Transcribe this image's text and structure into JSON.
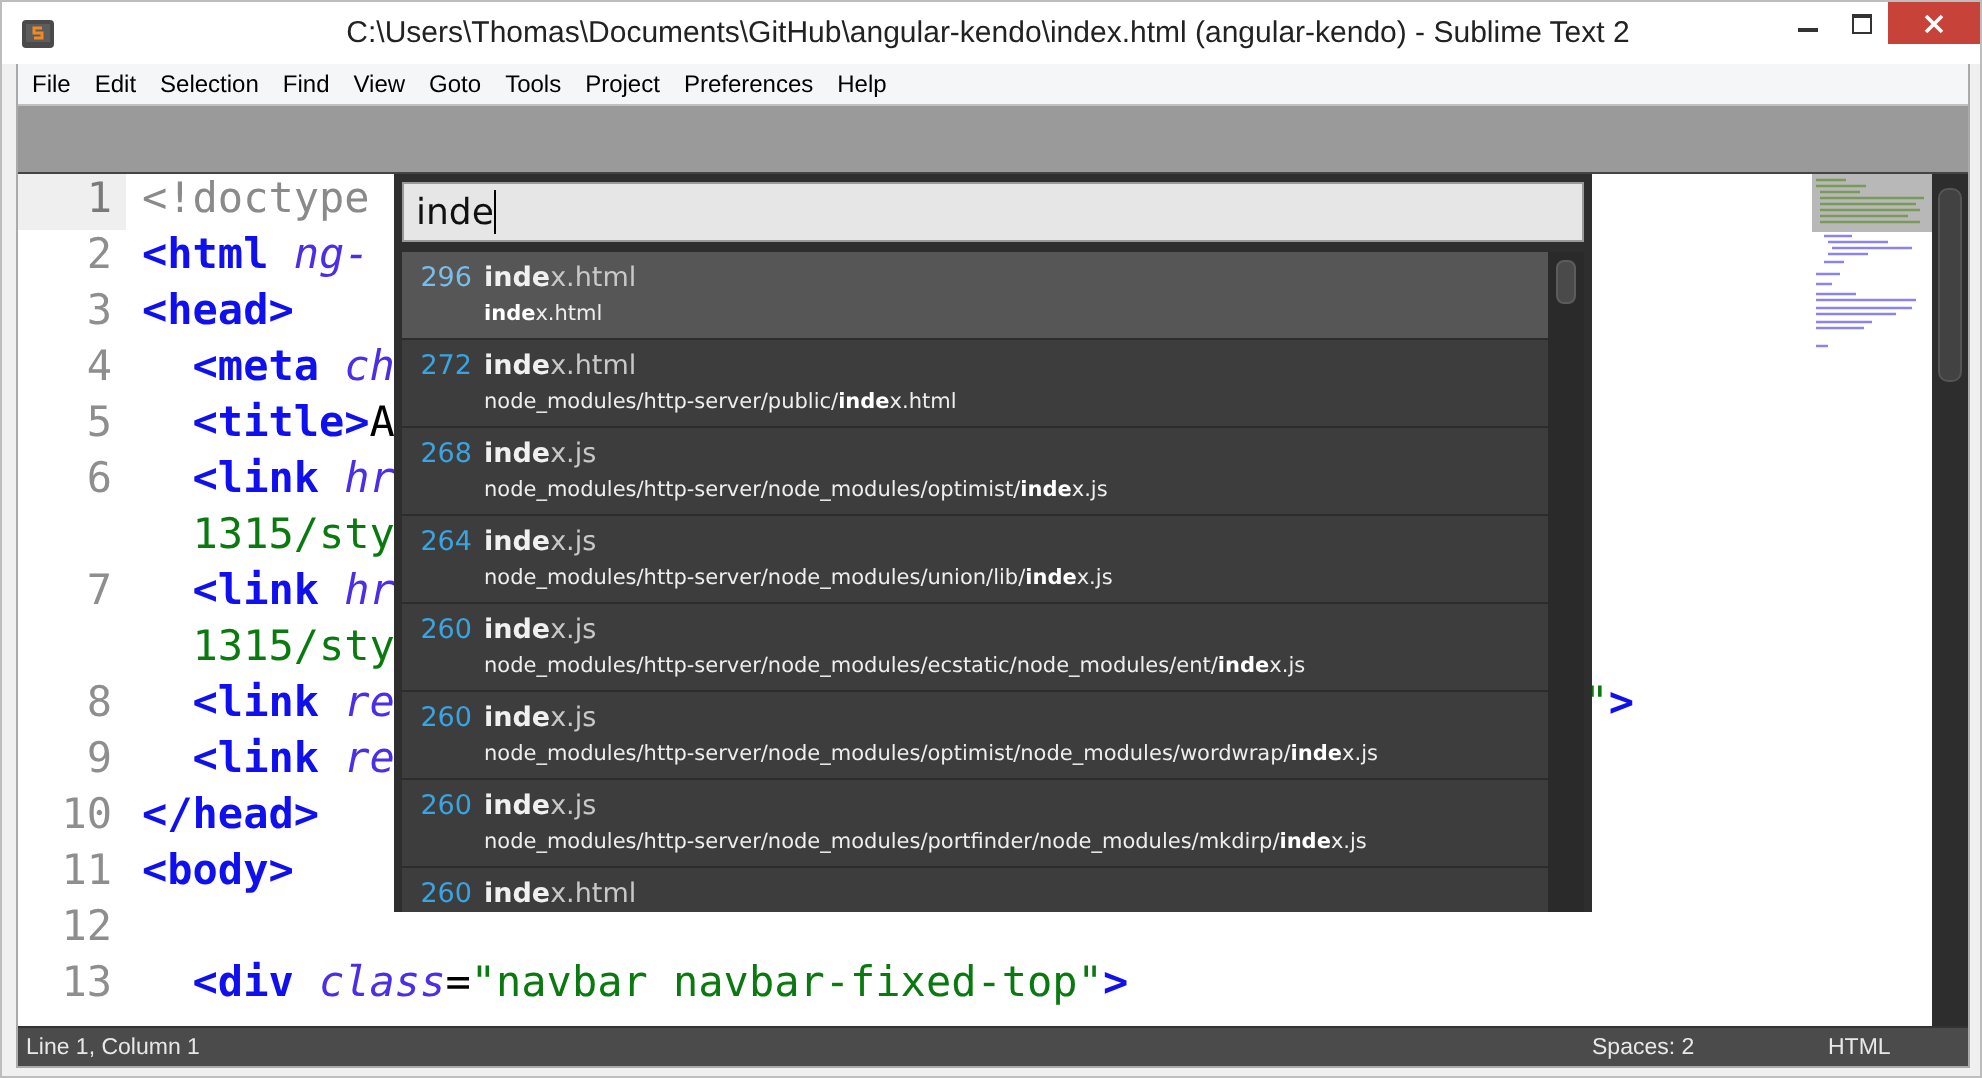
{
  "window": {
    "title": "C:\\Users\\Thomas\\Documents\\GitHub\\angular-kendo\\index.html (angular-kendo) - Sublime Text 2"
  },
  "menu": [
    "File",
    "Edit",
    "Selection",
    "Find",
    "View",
    "Goto",
    "Tools",
    "Project",
    "Preferences",
    "Help"
  ],
  "editor": {
    "lines": [
      {
        "number": "1",
        "current": true,
        "tokens": [
          {
            "kind": "doctype",
            "text": "<!doctype"
          }
        ]
      },
      {
        "number": "2",
        "current": false,
        "tokens": [
          {
            "kind": "tag",
            "text": "<html"
          },
          {
            "kind": "attr",
            "text": " ng-"
          }
        ]
      },
      {
        "number": "3",
        "current": false,
        "tokens": [
          {
            "kind": "tag",
            "text": "<head>"
          }
        ]
      },
      {
        "number": "4",
        "current": false,
        "indented": true,
        "tokens": [
          {
            "kind": "tag",
            "text": "<meta"
          },
          {
            "kind": "attr",
            "text": " ch"
          }
        ]
      },
      {
        "number": "5",
        "current": false,
        "indented": true,
        "tokens": [
          {
            "kind": "tag",
            "text": "<title>"
          },
          {
            "kind": "plain",
            "text": "A"
          }
        ]
      },
      {
        "number": "6",
        "current": false,
        "indented": true,
        "tokens": [
          {
            "kind": "tag",
            "text": "<link"
          },
          {
            "kind": "attr",
            "text": " hr"
          }
        ]
      },
      {
        "current": false,
        "indented": true,
        "tokens": [
          {
            "kind": "string",
            "text": "1315/sty"
          }
        ]
      },
      {
        "number": "7",
        "current": false,
        "indented": true,
        "tokens": [
          {
            "kind": "tag",
            "text": "<link"
          },
          {
            "kind": "attr",
            "text": " hr"
          }
        ]
      },
      {
        "current": false,
        "indented": true,
        "tokens": [
          {
            "kind": "string",
            "text": "1315/sty"
          }
        ]
      },
      {
        "number": "8",
        "current": false,
        "indented": true,
        "tokens": [
          {
            "kind": "tag",
            "text": "<link"
          },
          {
            "kind": "attr",
            "text": " re"
          }
        ],
        "tail": [
          {
            "kind": "string",
            "text": "\""
          },
          {
            "kind": "tag",
            "text": ">"
          }
        ]
      },
      {
        "number": "9",
        "current": false,
        "indented": true,
        "tokens": [
          {
            "kind": "tag",
            "text": "<link"
          },
          {
            "kind": "attr",
            "text": " re"
          }
        ]
      },
      {
        "number": "10",
        "current": false,
        "tokens": [
          {
            "kind": "tag",
            "text": "</head>"
          }
        ]
      },
      {
        "number": "11",
        "current": false,
        "tokens": [
          {
            "kind": "tag",
            "text": "<body>"
          }
        ]
      },
      {
        "number": "12",
        "current": false
      },
      {
        "number": "13",
        "current": false,
        "indented": true,
        "tokens": [
          {
            "kind": "tag",
            "text": "<div"
          },
          {
            "kind": "attr",
            "text": " class"
          },
          {
            "kind": "plain",
            "text": "="
          },
          {
            "kind": "string",
            "text": "\"navbar navbar-fixed-top\""
          },
          {
            "kind": "tag",
            "text": ">"
          }
        ]
      }
    ]
  },
  "goto_anything": {
    "value": "inde",
    "results": [
      {
        "score": "296",
        "name": "**inde**x.html",
        "path": "**inde**x.html",
        "selected": true
      },
      {
        "score": "272",
        "name": "**inde**x.html",
        "path": "node_modules/http-server/public/**inde**x.html",
        "selected": false
      },
      {
        "score": "268",
        "name": "**inde**x.js",
        "path": "node_modules/http-server/node_modules/optimist/**inde**x.js",
        "selected": false
      },
      {
        "score": "264",
        "name": "**inde**x.js",
        "path": "node_modules/http-server/node_modules/union/lib/**inde**x.js",
        "selected": false
      },
      {
        "score": "260",
        "name": "**inde**x.js",
        "path": "node_modules/http-server/node_modules/ecstatic/node_modules/ent/**inde**x.js",
        "selected": false
      },
      {
        "score": "260",
        "name": "**inde**x.js",
        "path": "node_modules/http-server/node_modules/optimist/node_modules/wordwrap/**inde**x.js",
        "selected": false
      },
      {
        "score": "260",
        "name": "**inde**x.js",
        "path": "node_modules/http-server/node_modules/portfinder/node_modules/mkdirp/**inde**x.js",
        "selected": false
      },
      {
        "score": "260",
        "name": "**inde**x.html",
        "selected": false
      }
    ]
  },
  "status_bar": {
    "position": "Line 1, Column 1",
    "indentation": "Spaces: 2",
    "syntax": "HTML"
  }
}
